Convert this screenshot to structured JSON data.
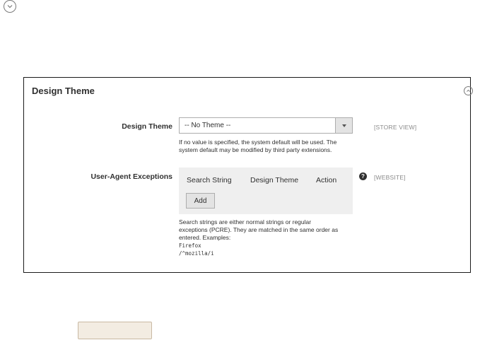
{
  "panel": {
    "title": "Design Theme"
  },
  "design_theme": {
    "label": "Design Theme",
    "selected": "-- No Theme --",
    "scope": "[STORE VIEW]",
    "note_line1": "If no value is specified, the system default will be used. The",
    "note_line2": "system default may be modified by third party extensions."
  },
  "exceptions": {
    "label": "User-Agent Exceptions",
    "scope": "[WEBSITE]",
    "columns": [
      "Search String",
      "Design Theme",
      "Action"
    ],
    "add_label": "Add",
    "help_glyph": "?",
    "note_line1": "Search strings are either normal strings or regular",
    "note_line2": "exceptions (PCRE). They are matched in the same order as",
    "note_line3": "entered. Examples:",
    "example1": "Firefox",
    "example2": "/^mozilla/i"
  },
  "icons": {
    "top": "chevron-down-circle-icon",
    "collapse": "chevron-up-circle-icon",
    "help": "question-circle-icon"
  },
  "colors": {
    "panel_border": "#1a1a1a",
    "grid_bg": "#efefef",
    "scope_text": "#8a8a8a",
    "bottom_button_bg": "#f3ece2"
  }
}
